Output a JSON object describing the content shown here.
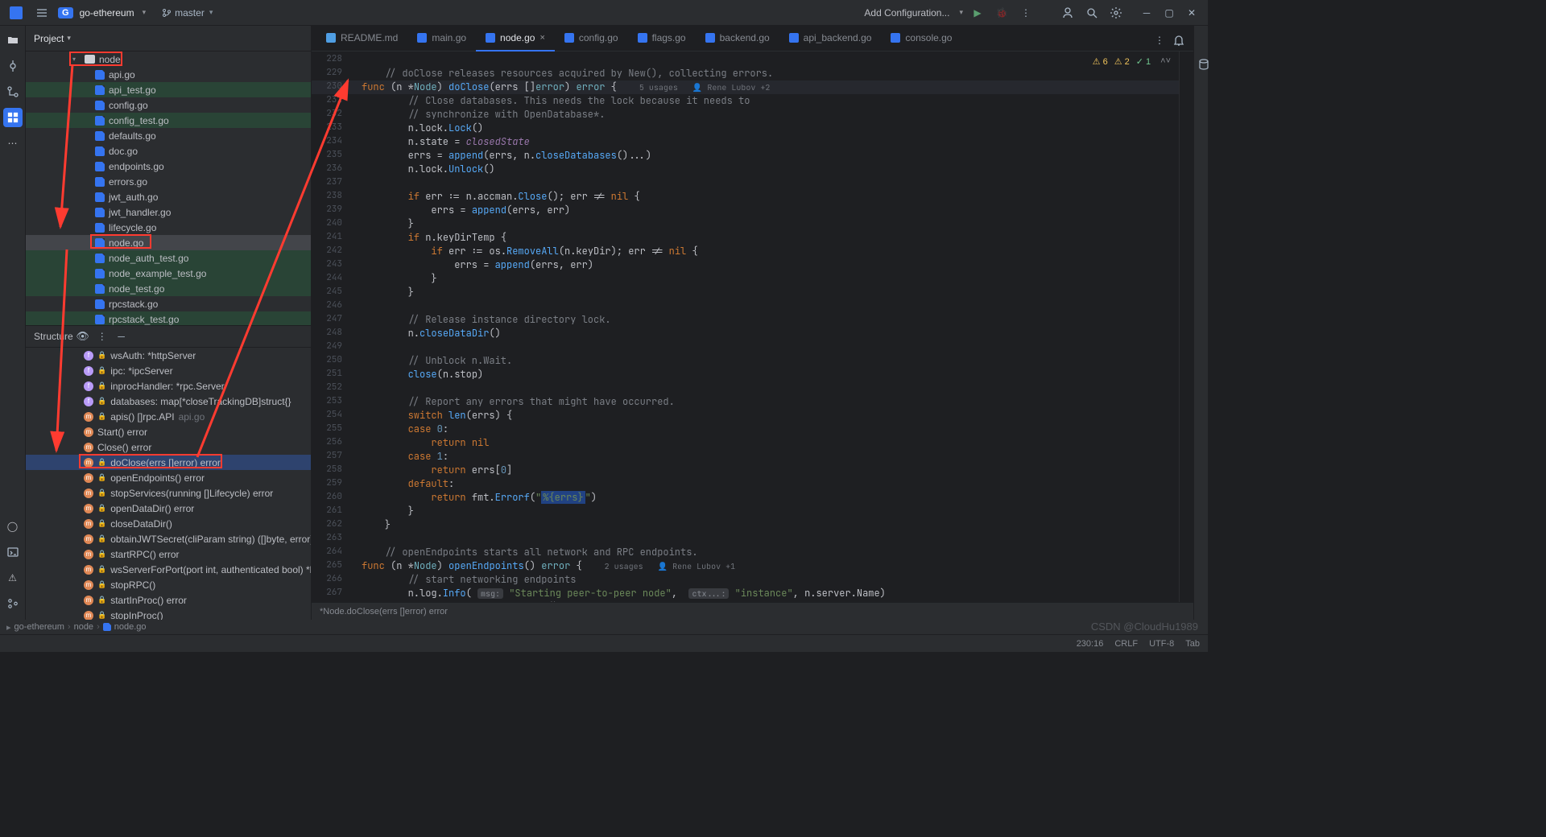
{
  "title": {
    "project": "go-ethereum",
    "projectBadge": "G",
    "branch": "master"
  },
  "runConfig": "Add Configuration...",
  "projectPanel": {
    "title": "Project"
  },
  "tree": {
    "folder": "node",
    "files": [
      {
        "n": "api.go",
        "g": 0
      },
      {
        "n": "api_test.go",
        "g": 1
      },
      {
        "n": "config.go",
        "g": 0
      },
      {
        "n": "config_test.go",
        "g": 1
      },
      {
        "n": "defaults.go",
        "g": 0
      },
      {
        "n": "doc.go",
        "g": 0
      },
      {
        "n": "endpoints.go",
        "g": 0
      },
      {
        "n": "errors.go",
        "g": 0
      },
      {
        "n": "jwt_auth.go",
        "g": 0
      },
      {
        "n": "jwt_handler.go",
        "g": 0
      },
      {
        "n": "lifecycle.go",
        "g": 0
      },
      {
        "n": "node.go",
        "g": 0,
        "sel": 1
      },
      {
        "n": "node_auth_test.go",
        "g": 1
      },
      {
        "n": "node_example_test.go",
        "g": 1
      },
      {
        "n": "node_test.go",
        "g": 1
      },
      {
        "n": "rpcstack.go",
        "g": 0
      },
      {
        "n": "rpcstack_test.go",
        "g": 1
      }
    ]
  },
  "structure": {
    "title": "Structure",
    "items": [
      {
        "ic": "f",
        "t": "wsAuth: *httpServer"
      },
      {
        "ic": "f",
        "t": "ipc: *ipcServer"
      },
      {
        "ic": "f",
        "t": "inprocHandler: *rpc.Server"
      },
      {
        "ic": "f",
        "t": "databases: map[*closeTrackingDB]struct{}"
      },
      {
        "ic": "m",
        "t": "apis() []rpc.API",
        "suf": "api.go"
      },
      {
        "ic": "m",
        "t": "Start() error",
        "pub": 1
      },
      {
        "ic": "m",
        "t": "Close() error",
        "pub": 1
      },
      {
        "ic": "m",
        "t": "doClose(errs []error) error",
        "sel": 1
      },
      {
        "ic": "m",
        "t": "openEndpoints() error"
      },
      {
        "ic": "m",
        "t": "stopServices(running []Lifecycle) error"
      },
      {
        "ic": "m",
        "t": "openDataDir() error"
      },
      {
        "ic": "m",
        "t": "closeDataDir()"
      },
      {
        "ic": "m",
        "t": "obtainJWTSecret(cliParam string) ([]byte, error)"
      },
      {
        "ic": "m",
        "t": "startRPC() error"
      },
      {
        "ic": "m",
        "t": "wsServerForPort(port int, authenticated bool) *httpServer"
      },
      {
        "ic": "m",
        "t": "stopRPC()"
      },
      {
        "ic": "m",
        "t": "startInProc() error"
      },
      {
        "ic": "m",
        "t": "stopInProc()"
      }
    ]
  },
  "tabs": [
    {
      "n": "README.md",
      "md": 1
    },
    {
      "n": "main.go"
    },
    {
      "n": "node.go",
      "active": 1,
      "close": 1
    },
    {
      "n": "config.go"
    },
    {
      "n": "flags.go"
    },
    {
      "n": "backend.go"
    },
    {
      "n": "api_backend.go"
    },
    {
      "n": "console.go"
    }
  ],
  "warnings": {
    "yellow1": "6",
    "yellow2": "2",
    "green": "1"
  },
  "code": {
    "start": 228,
    "hl": 230,
    "lines": [
      "",
      "\t// doClose releases resources acquired by New(), collecting errors.",
      [
        "func ",
        "(",
        "n ",
        "*",
        "Node",
        ")",
        " doClose",
        "(",
        "errs ",
        "[]",
        "error",
        ")",
        " error",
        " {",
        "   5 usages   ",
        "👤 Rene Lubov +2"
      ],
      "\t\t// Close databases. This needs the lock because it needs to",
      "\t\t// synchronize with OpenDatabase*.",
      [
        "\t\tn",
        ".",
        "lock",
        ".",
        "Lock",
        "()"
      ],
      [
        "\t\tn",
        ".",
        "state",
        " = ",
        "closedState"
      ],
      [
        "\t\terrs",
        " = ",
        "append",
        "(",
        "errs",
        ", n.",
        "closeDatabases",
        "()",
        "...)"
      ],
      [
        "\t\tn",
        ".",
        "lock",
        ".",
        "Unlock",
        "()"
      ],
      "",
      [
        "\t\t",
        "if",
        " err := n.",
        "accman",
        ".",
        "Close",
        "(); err != ",
        "nil",
        " {"
      ],
      [
        "\t\t\terrs",
        " = ",
        "append",
        "(",
        "errs",
        ", err)"
      ],
      "\t\t}",
      [
        "\t\t",
        "if",
        " n.",
        "keyDirTemp",
        " {"
      ],
      [
        "\t\t\t",
        "if",
        " err := os.",
        "RemoveAll",
        "(",
        "n.",
        "keyDir",
        "); err != ",
        "nil",
        " {"
      ],
      [
        "\t\t\t\terrs",
        " = ",
        "append",
        "(",
        "errs",
        ", err)"
      ],
      "\t\t\t}",
      "\t\t}",
      "",
      "\t\t// Release instance directory lock.",
      [
        "\t\tn.",
        "closeDataDir",
        "()"
      ],
      "",
      "\t\t// Unblock n.Wait.",
      [
        "\t\t",
        "close",
        "(",
        "n.",
        "stop",
        ")"
      ],
      "",
      "\t\t// Report any errors that might have occurred.",
      [
        "\t\t",
        "switch",
        " ",
        "len",
        "(",
        "errs",
        ") {"
      ],
      [
        "\t\t",
        "case",
        " ",
        "0",
        ":"
      ],
      [
        "\t\t\t",
        "return",
        " ",
        "nil"
      ],
      [
        "\t\t",
        "case",
        " ",
        "1",
        ":"
      ],
      [
        "\t\t\t",
        "return",
        " errs[",
        "0",
        "]"
      ],
      [
        "\t\t",
        "default",
        ":"
      ],
      [
        "\t\t\t",
        "return",
        " fmt.",
        "Errorf",
        "(",
        "\"%{errs}\"",
        ")"
      ],
      "\t\t}",
      "\t}",
      "",
      "\t// openEndpoints starts all network and RPC endpoints.",
      [
        "func ",
        "(",
        "n ",
        "*",
        "Node",
        ")",
        " openEndpoints",
        "()",
        " error",
        " {",
        "   2 usages   ",
        "👤 Rene Lubov +1"
      ],
      "\t\t// start networking endpoints",
      [
        "\t\tn.",
        "log",
        ".",
        "Info",
        "( ",
        "msg:",
        " ",
        "\"Starting peer-to-peer node\"",
        ",  ",
        "ctx...:",
        " ",
        "\"instance\"",
        ", n.",
        "server",
        ".",
        "Name",
        ")"
      ],
      [
        "\t\t",
        "if",
        " err := n.",
        "server",
        ".",
        "Start",
        "(); err != ",
        "nil",
        " ; ",
        "convertFileLockError(err) →"
      ]
    ]
  },
  "breadcrumb2": "*Node.doClose(errs []error) error",
  "statusbar": {
    "pos": "230:16",
    "crlf": "CRLF",
    "enc": "UTF-8",
    "indent": "Tab"
  },
  "footer": [
    "go-ethereum",
    "node",
    "node.go"
  ],
  "watermark": "CSDN @CloudHu1989"
}
